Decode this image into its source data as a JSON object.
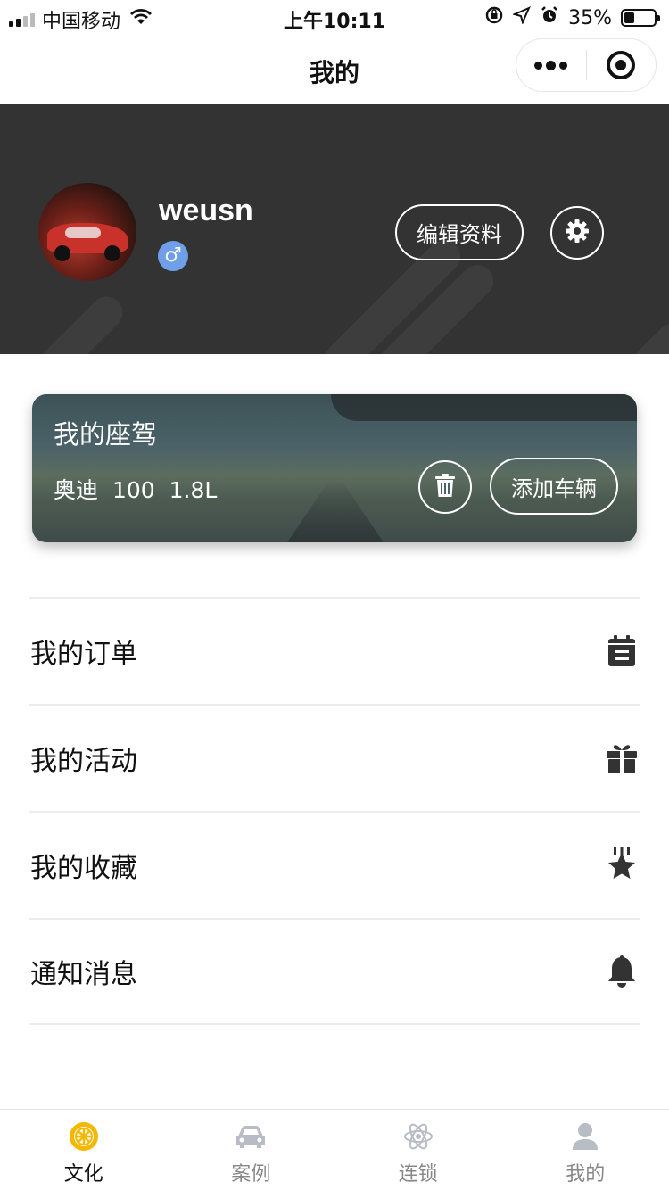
{
  "status_bar": {
    "carrier": "中国移动",
    "time": "上午10:11",
    "battery": "35%",
    "battery_level": 0.35
  },
  "nav": {
    "title": "我的"
  },
  "profile": {
    "username": "weusn",
    "gender_symbol": "♂",
    "edit_label": "编辑资料",
    "colors": {
      "header_bg": "#333333",
      "gender_badge": "#6f9fe8"
    }
  },
  "car_card": {
    "title": "我的座驾",
    "brand": "奥迪",
    "model": "100",
    "engine": "1.8L",
    "add_label": "添加车辆"
  },
  "menu": {
    "items": [
      {
        "label": "我的订单",
        "icon": "order-calendar-icon"
      },
      {
        "label": "我的活动",
        "icon": "gift-icon"
      },
      {
        "label": "我的收藏",
        "icon": "star-favorite-icon"
      },
      {
        "label": "通知消息",
        "icon": "bell-icon"
      }
    ]
  },
  "tab_bar": {
    "tabs": [
      {
        "label": "文化",
        "icon": "wheel-icon",
        "active": true
      },
      {
        "label": "案例",
        "icon": "car-icon",
        "active": false
      },
      {
        "label": "连锁",
        "icon": "atom-icon",
        "active": false
      },
      {
        "label": "我的",
        "icon": "user-icon",
        "active": false
      }
    ],
    "colors": {
      "active_icon": "#f5b800",
      "inactive_icon": "#b8bcc4"
    }
  }
}
